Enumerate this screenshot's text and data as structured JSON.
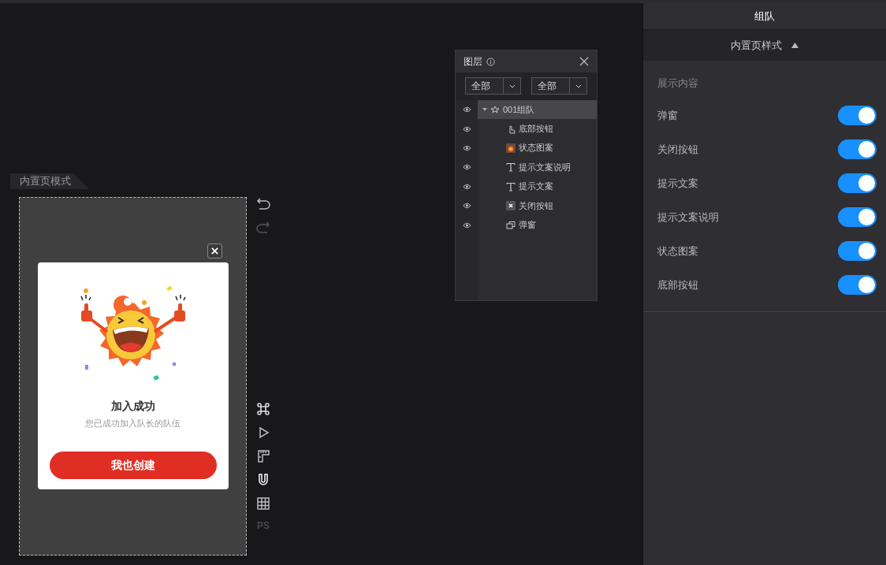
{
  "canvas": {
    "mode_tab": "内置页模式",
    "popup": {
      "title": "加入成功",
      "subtitle": "您已成功加入队长的队伍",
      "button": "我也创建"
    },
    "toolbar": {
      "ps_label": "PS"
    }
  },
  "layers_panel": {
    "title": "图层",
    "filters": [
      {
        "value": "全部"
      },
      {
        "value": "全部"
      }
    ],
    "tree": [
      {
        "label": "001组队",
        "kind": "group",
        "expanded": true,
        "selected": true,
        "children": [
          {
            "label": "底部按钮",
            "kind": "pointer",
            "selected": false
          },
          {
            "label": "状态图案",
            "kind": "image",
            "selected": false
          },
          {
            "label": "提示文案说明",
            "kind": "text",
            "selected": false
          },
          {
            "label": "提示文案",
            "kind": "text",
            "selected": false
          },
          {
            "label": "关闭按钮",
            "kind": "close",
            "selected": false
          },
          {
            "label": "弹窗",
            "kind": "popup",
            "selected": false
          }
        ]
      }
    ]
  },
  "settings": {
    "title": "组队",
    "section": {
      "title": "内置页样式",
      "expanded": true
    },
    "group_label": "展示内容",
    "toggles": [
      {
        "label": "弹窗",
        "on": true
      },
      {
        "label": "关闭按钮",
        "on": true
      },
      {
        "label": "提示文案",
        "on": true
      },
      {
        "label": "提示文案说明",
        "on": true
      },
      {
        "label": "状态图案",
        "on": true
      },
      {
        "label": "底部按钮",
        "on": true
      }
    ]
  }
}
